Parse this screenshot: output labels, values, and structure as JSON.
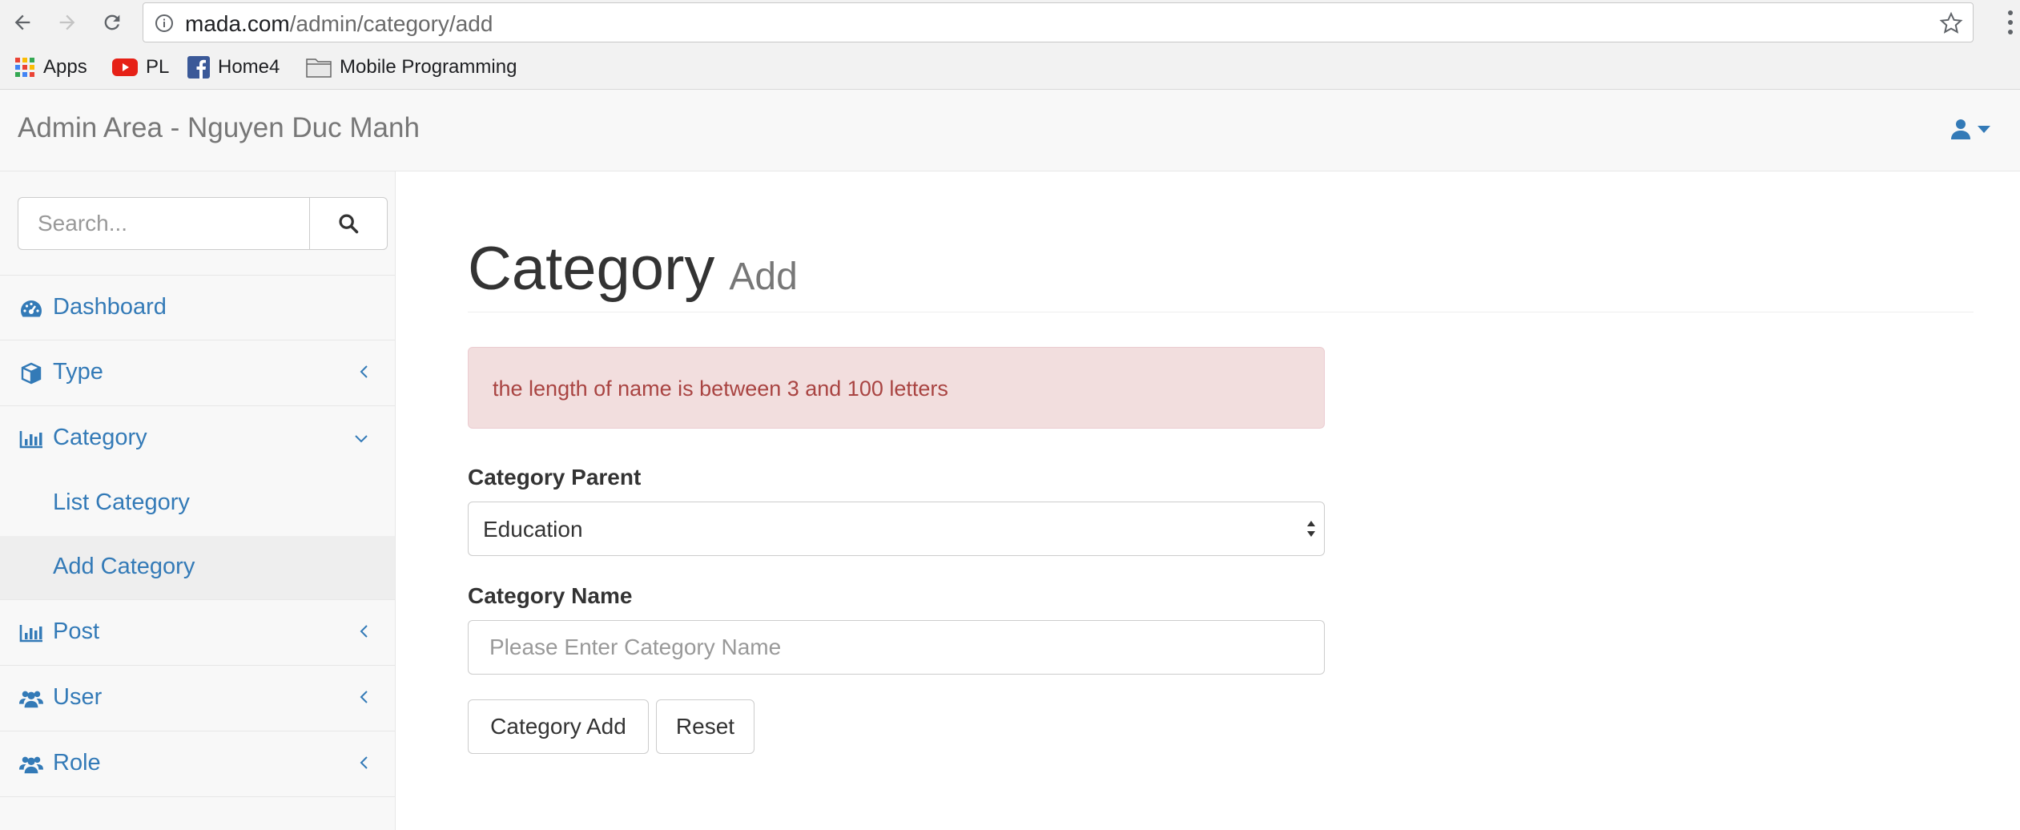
{
  "browser": {
    "url_host": "mada.com",
    "url_path": "/admin/category/add",
    "bookmarks": [
      {
        "label": "Apps",
        "icon": "apps-grid-icon"
      },
      {
        "label": "PL",
        "icon": "youtube-icon"
      },
      {
        "label": "Home4",
        "icon": "facebook-icon"
      },
      {
        "label": "Mobile Programming",
        "icon": "folder-icon"
      }
    ]
  },
  "navbar": {
    "brand": "Admin Area - Nguyen Duc Manh",
    "user_icon": "user-icon"
  },
  "sidebar": {
    "search_placeholder": "Search...",
    "items": [
      {
        "label": "Dashboard",
        "icon": "dashboard-icon",
        "expandable": false
      },
      {
        "label": "Type",
        "icon": "cube-icon",
        "expandable": true,
        "expanded": false
      },
      {
        "label": "Category",
        "icon": "bar-chart-icon",
        "expandable": true,
        "expanded": true,
        "children": [
          {
            "label": "List Category",
            "active": false
          },
          {
            "label": "Add Category",
            "active": true
          }
        ]
      },
      {
        "label": "Post",
        "icon": "bar-chart-icon",
        "expandable": true,
        "expanded": false
      },
      {
        "label": "User",
        "icon": "users-icon",
        "expandable": true,
        "expanded": false
      },
      {
        "label": "Role",
        "icon": "users-icon",
        "expandable": true,
        "expanded": false
      }
    ]
  },
  "main": {
    "title": "Category",
    "subtitle": "Add",
    "alert": "the length of name is between 3 and 100 letters",
    "parent_label": "Category Parent",
    "parent_value": "Education",
    "name_label": "Category Name",
    "name_placeholder": "Please Enter Category Name",
    "name_value": "",
    "submit_label": "Category Add",
    "reset_label": "Reset"
  },
  "colors": {
    "link": "#337ab7",
    "alert_bg": "#f2dede",
    "alert_text": "#a94442",
    "brand_text": "#777777"
  }
}
